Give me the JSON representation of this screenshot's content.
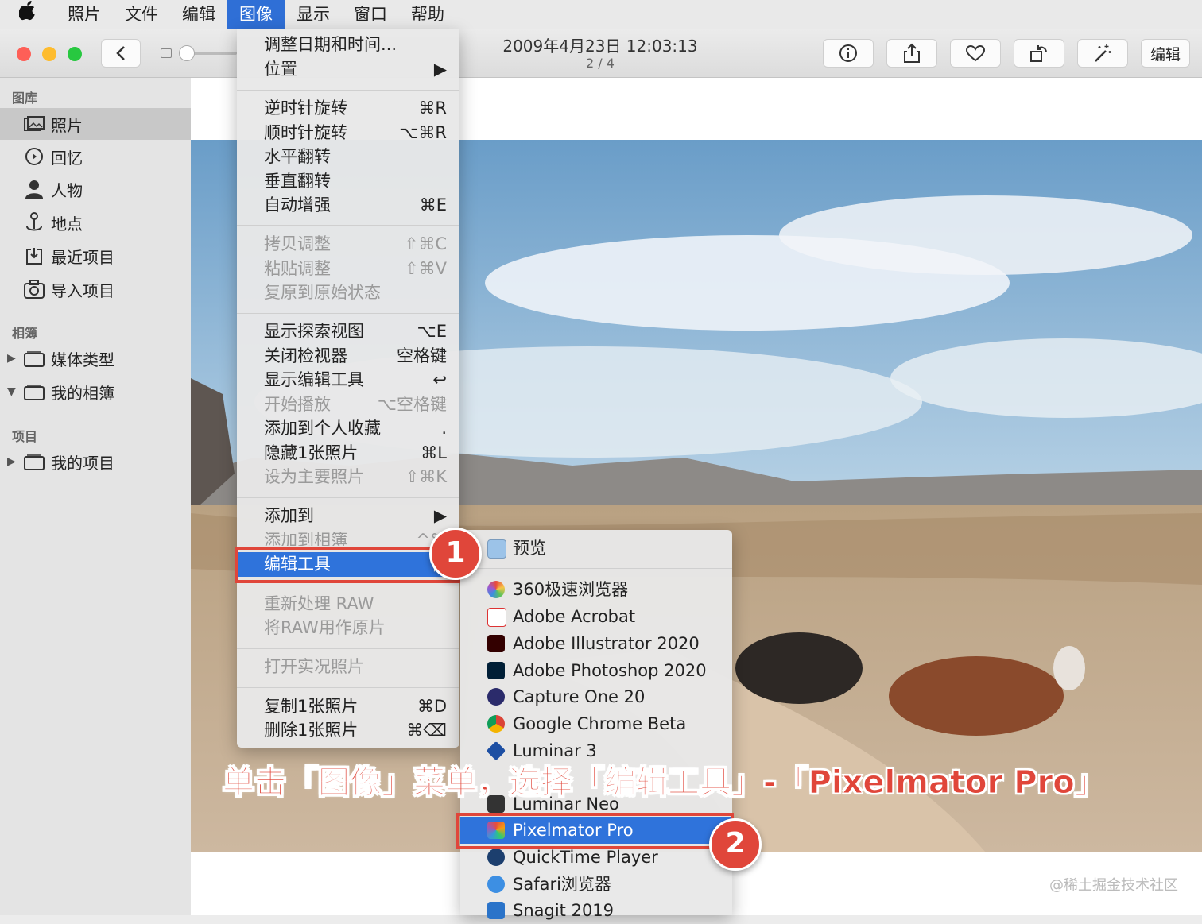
{
  "menubar": {
    "items": [
      "照片",
      "文件",
      "编辑",
      "图像",
      "显示",
      "窗口",
      "帮助"
    ],
    "active_index": 3
  },
  "toolbar": {
    "title": "2009年4月23日 12:03:13",
    "subtitle": "2 / 4",
    "edit_label": "编辑",
    "colors": {
      "close": "#fe5f57",
      "minimize": "#febc2e",
      "zoom": "#28c840"
    }
  },
  "sidebar": {
    "library_header": "图库",
    "library_items": [
      "照片",
      "回忆",
      "人物",
      "地点",
      "最近项目",
      "导入项目"
    ],
    "albums_header": "相簿",
    "album_items": [
      "媒体类型",
      "我的相簿"
    ],
    "projects_header": "项目",
    "project_items": [
      "我的项目"
    ]
  },
  "image_menu": {
    "items": [
      {
        "label": "调整日期和时间...",
        "shortcut": ""
      },
      {
        "label": "位置",
        "shortcut": "▶"
      },
      {
        "label": "逆时针旋转",
        "shortcut": "⌘R"
      },
      {
        "label": "顺时针旋转",
        "shortcut": "⌥⌘R"
      },
      {
        "label": "水平翻转",
        "shortcut": ""
      },
      {
        "label": "垂直翻转",
        "shortcut": ""
      },
      {
        "label": "自动增强",
        "shortcut": "⌘E"
      },
      {
        "label": "拷贝调整",
        "shortcut": "⇧⌘C"
      },
      {
        "label": "粘贴调整",
        "shortcut": "⇧⌘V"
      },
      {
        "label": "复原到原始状态",
        "shortcut": ""
      },
      {
        "label": "显示探索视图",
        "shortcut": "⌥E"
      },
      {
        "label": "关闭检视器",
        "shortcut": "空格键"
      },
      {
        "label": "显示编辑工具",
        "shortcut": "↩"
      },
      {
        "label": "开始播放",
        "shortcut": "⌥空格键"
      },
      {
        "label": "添加到个人收藏",
        "shortcut": "."
      },
      {
        "label": "隐藏1张照片",
        "shortcut": "⌘L"
      },
      {
        "label": "设为主要照片",
        "shortcut": "⇧⌘K"
      },
      {
        "label": "添加到",
        "shortcut": "▶"
      },
      {
        "label": "添加到相簿",
        "shortcut": "^⌘"
      },
      {
        "label": "编辑工具",
        "shortcut": "▶"
      },
      {
        "label": "重新处理 RAW",
        "shortcut": ""
      },
      {
        "label": "将RAW用作原片",
        "shortcut": ""
      },
      {
        "label": "打开实况照片",
        "shortcut": ""
      },
      {
        "label": "复制1张照片",
        "shortcut": "⌘D"
      },
      {
        "label": "删除1张照片",
        "shortcut": "⌘⌫"
      }
    ]
  },
  "edit_tools_submenu": {
    "items": [
      "预览",
      "360极速浏览器",
      "Adobe Acrobat",
      "Adobe Illustrator 2020",
      "Adobe Photoshop 2020",
      "Capture One 20",
      "Google Chrome Beta",
      "Luminar 3",
      "Luminar Neo",
      "Pixelmator Pro",
      "QuickTime Player",
      "Safari浏览器",
      "Snagit 2019"
    ]
  },
  "annotations": {
    "step1": "1",
    "step2": "2",
    "caption": "单击「图像」菜单，选择「编辑工具」-「Pixelmator Pro」",
    "watermark": "@稀土掘金技术社区",
    "accent_color": "#e0463a"
  }
}
